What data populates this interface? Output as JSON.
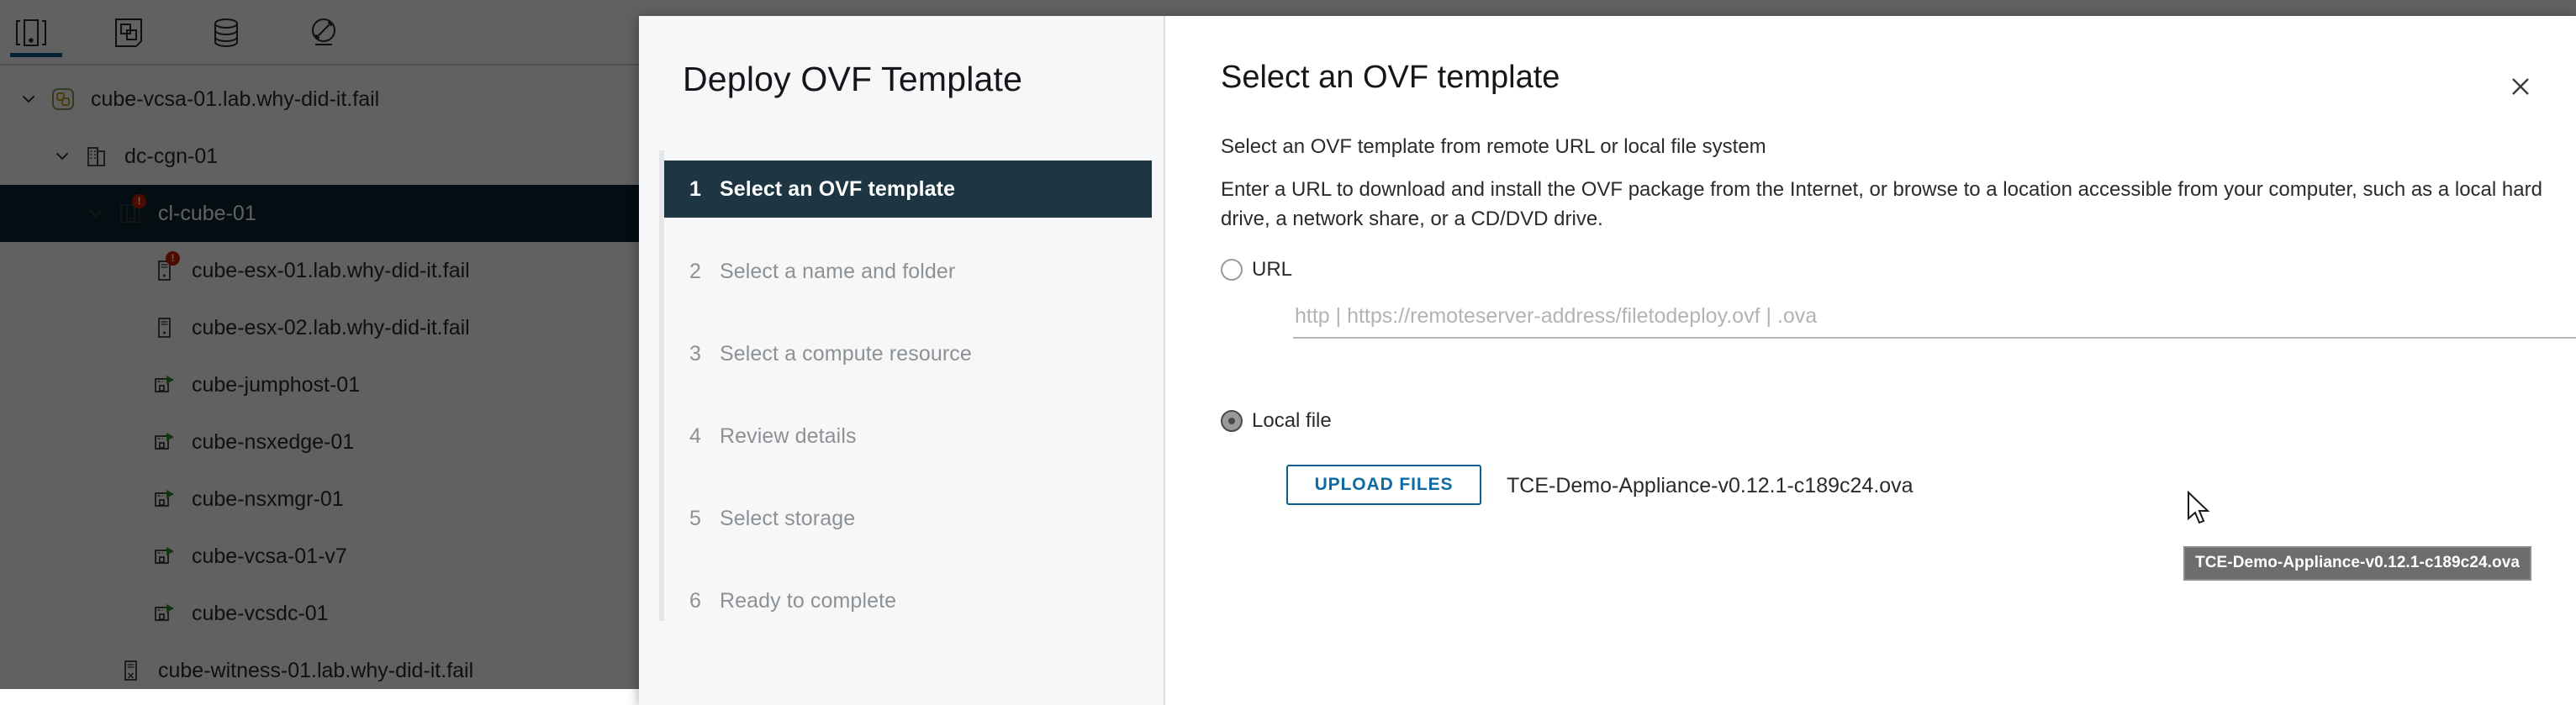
{
  "background": {
    "toolbar": {
      "tabs": [
        {
          "name": "hosts-and-clusters",
          "icon": "hosts-clusters-icon",
          "selected": true
        },
        {
          "name": "vms-and-templates",
          "icon": "vms-templates-icon",
          "selected": false
        },
        {
          "name": "storage",
          "icon": "datastore-icon",
          "selected": false
        },
        {
          "name": "networking",
          "icon": "network-icon",
          "selected": false
        }
      ],
      "accent_color": "#0d5e8c"
    },
    "tree": {
      "items": [
        {
          "label": "cube-vcsa-01.lab.why-did-it.fail",
          "icon": "vcenter-icon",
          "depth": 0,
          "caret": "down",
          "selected": false,
          "alert": false
        },
        {
          "label": "dc-cgn-01",
          "icon": "datacenter-icon",
          "depth": 1,
          "caret": "down",
          "selected": false,
          "alert": false
        },
        {
          "label": "cl-cube-01",
          "icon": "cluster-icon",
          "depth": 2,
          "caret": "down",
          "selected": true,
          "alert": true
        },
        {
          "label": "cube-esx-01.lab.why-did-it.fail",
          "icon": "host-icon",
          "depth": 3,
          "caret": "none",
          "selected": false,
          "alert": true
        },
        {
          "label": "cube-esx-02.lab.why-did-it.fail",
          "icon": "host-icon",
          "depth": 3,
          "caret": "none",
          "selected": false,
          "alert": false
        },
        {
          "label": "cube-jumphost-01",
          "icon": "vm-powered-on-icon",
          "depth": 3,
          "caret": "none",
          "selected": false,
          "alert": false
        },
        {
          "label": "cube-nsxedge-01",
          "icon": "vm-powered-on-icon",
          "depth": 3,
          "caret": "none",
          "selected": false,
          "alert": false
        },
        {
          "label": "cube-nsxmgr-01",
          "icon": "vm-powered-on-icon",
          "depth": 3,
          "caret": "none",
          "selected": false,
          "alert": false
        },
        {
          "label": "cube-vcsa-01-v7",
          "icon": "vm-powered-on-icon",
          "depth": 3,
          "caret": "none",
          "selected": false,
          "alert": false
        },
        {
          "label": "cube-vcsdc-01",
          "icon": "vm-powered-on-icon",
          "depth": 3,
          "caret": "none",
          "selected": false,
          "alert": false
        },
        {
          "label": "cube-witness-01.lab.why-did-it.fail",
          "icon": "witness-host-icon",
          "depth": 2,
          "caret": "none",
          "selected": false,
          "alert": false
        }
      ]
    }
  },
  "modal": {
    "title": "Deploy OVF Template",
    "close_label": "close-icon",
    "steps": [
      {
        "num": "1",
        "label": "Select an OVF template",
        "active": true
      },
      {
        "num": "2",
        "label": "Select a name and folder",
        "active": false
      },
      {
        "num": "3",
        "label": "Select a compute resource",
        "active": false
      },
      {
        "num": "4",
        "label": "Review details",
        "active": false
      },
      {
        "num": "5",
        "label": "Select storage",
        "active": false
      },
      {
        "num": "6",
        "label": "Ready to complete",
        "active": false
      }
    ],
    "panel": {
      "heading": "Select an OVF template",
      "subheading": "Select an OVF template from remote URL or local file system",
      "description": "Enter a URL to download and install the OVF package from the Internet, or browse to a location accessible from your computer, such as a local hard drive, a network share, or a CD/DVD drive.",
      "radio_url_label": "URL",
      "radio_local_label": "Local file",
      "selected_source": "Local file",
      "url_value": "",
      "url_placeholder": "http | https://remoteserver-address/filetodeploy.ovf | .ova",
      "upload_button_label": "UPLOAD FILES",
      "file_name": "TCE-Demo-Appliance-v0.12.1-c189c24.ova",
      "tooltip_text": "TCE-Demo-Appliance-v0.12.1-c189c24.ova"
    },
    "colors": {
      "active_step_bg": "#1d3642",
      "link_blue": "#0d6ba3",
      "tooltip_bg": "#6d6d6d"
    }
  }
}
